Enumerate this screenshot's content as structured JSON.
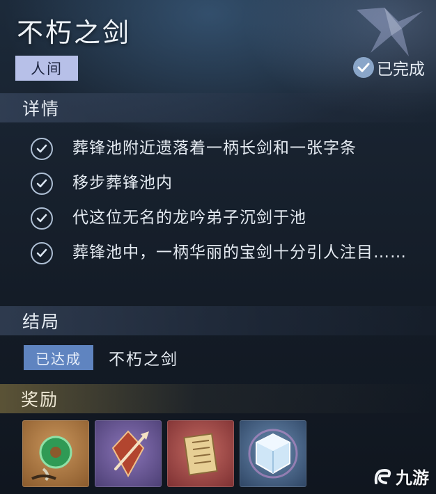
{
  "quest": {
    "title": "不朽之剑",
    "realm_tag": "人间",
    "status_label": "已完成"
  },
  "details": {
    "header": "详情",
    "tasks": [
      {
        "text": "葬锋池附近遗落着一柄长剑和一张字条",
        "done": true
      },
      {
        "text": "移步葬锋池内",
        "done": true
      },
      {
        "text": "代这位无名的龙吟弟子沉剑于池",
        "done": true
      },
      {
        "text": "葬锋池中，一柄华丽的宝剑十分引人注目……",
        "done": true
      }
    ]
  },
  "ending": {
    "header": "结局",
    "badge": "已达成",
    "name": "不朽之剑"
  },
  "rewards": {
    "header": "奖励",
    "items": [
      {
        "icon": "jade-pendant-icon",
        "rarity_color": "#a8743f"
      },
      {
        "icon": "blade-emblem-icon",
        "rarity_color": "#6f5b98"
      },
      {
        "icon": "scroll-note-icon",
        "rarity_color": "#a24a4a"
      },
      {
        "icon": "ice-cube-icon",
        "rarity_color": "#4b6b8e"
      }
    ]
  },
  "watermark": {
    "text": "九游"
  }
}
